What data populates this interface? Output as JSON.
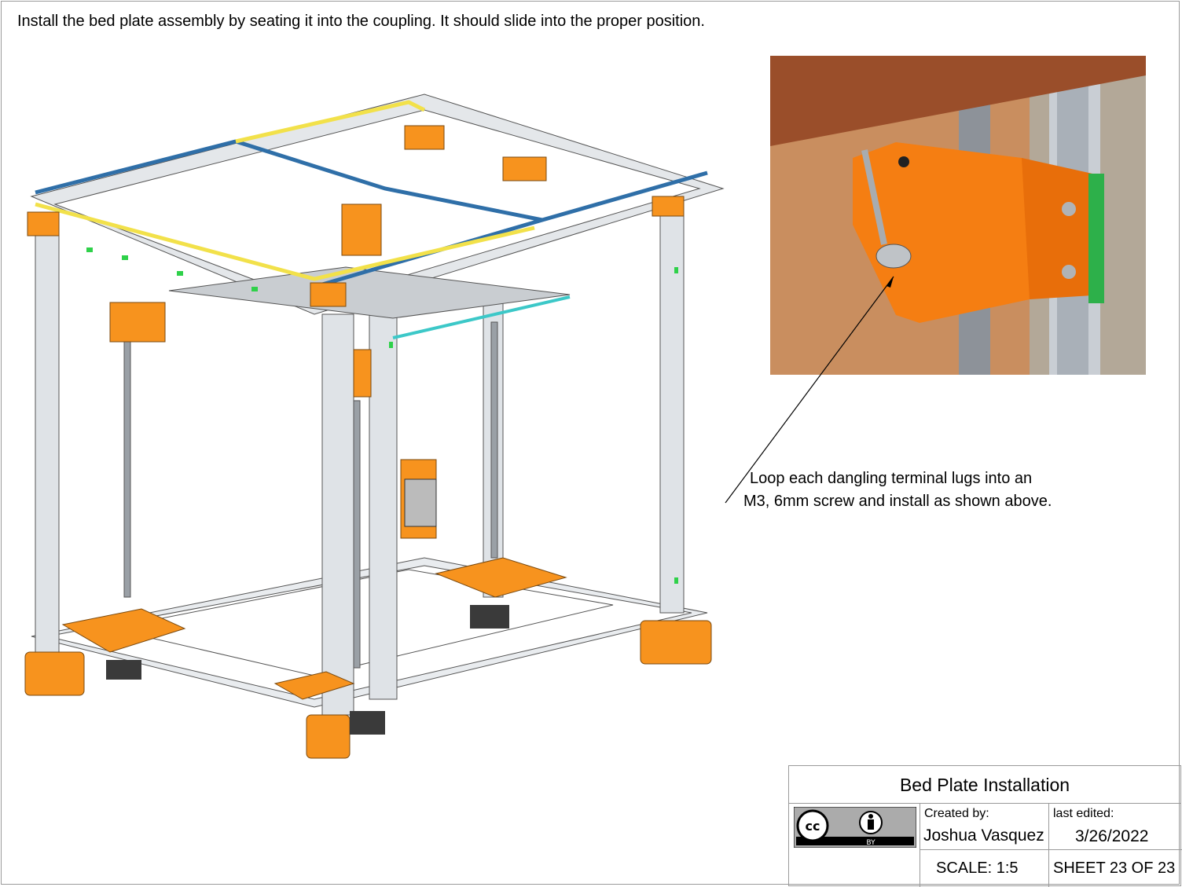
{
  "instruction": "Install the bed plate assembly by seating it into the coupling. It should slide into the proper position.",
  "callout": {
    "line1": "Loop each dangling terminal lugs into an",
    "line2": "M3, 6mm screw and install as shown above."
  },
  "title_block": {
    "title": "Bed Plate Installation",
    "created_by_label": "Created by:",
    "author": "Joshua Vasquez",
    "last_edited_label": "last edited:",
    "date": "3/26/2022",
    "scale": "SCALE: 1:5",
    "sheet": "SHEET 23 OF 23",
    "license_text": "cc",
    "license_by": "BY"
  },
  "colors": {
    "printed_part": "#f7931e",
    "aluminum": "#d8dde2",
    "belt_blue": "#2f6fa8",
    "belt_yellow": "#f2e14a",
    "rail_green": "#2fd14a",
    "bed_edge": "#3cc8c8"
  }
}
